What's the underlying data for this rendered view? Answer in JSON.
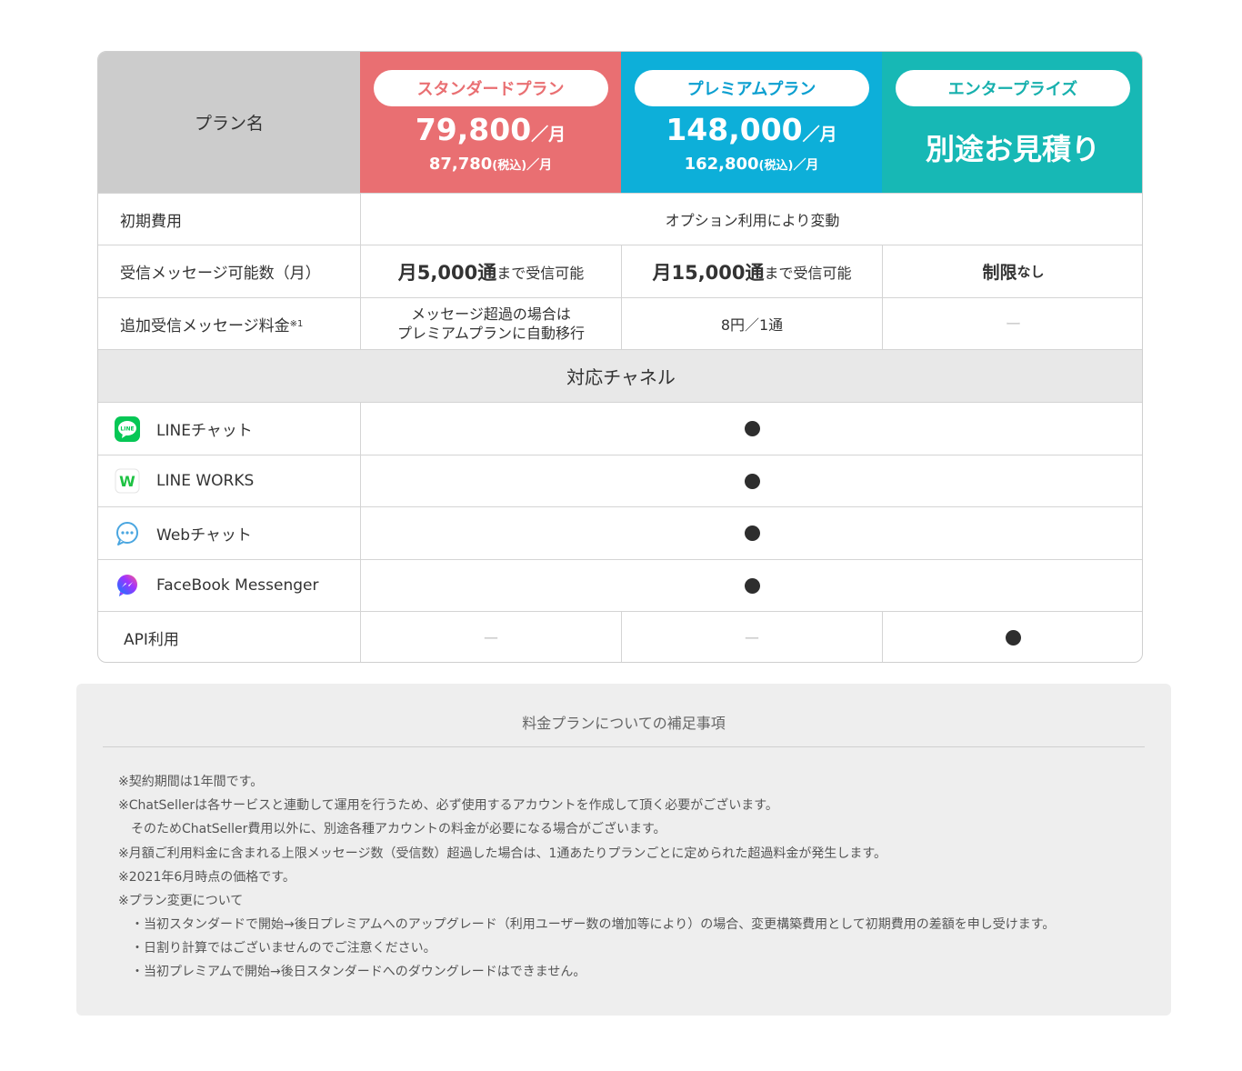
{
  "header": {
    "plan_label": "プラン名",
    "standard": {
      "name": "スタンダードプラン",
      "price": "79,800",
      "unit": "／月",
      "tax_price": "87,780",
      "tax_label": "(税込)",
      "tax_unit": "／月"
    },
    "premium": {
      "name": "プレミアムプラン",
      "price": "148,000",
      "unit": "／月",
      "tax_price": "162,800",
      "tax_label": "(税込)",
      "tax_unit": "／月"
    },
    "enterprise": {
      "name": "エンタープライズ",
      "price": "別途お見積り"
    }
  },
  "rows": {
    "initial": {
      "label": "初期費用",
      "value": "オプション利用により変動"
    },
    "messages": {
      "label": "受信メッセージ可能数（月）",
      "standard_bold": "月5,000通",
      "standard_rest": "まで受信可能",
      "premium_bold": "月15,000通",
      "premium_rest": "まで受信可能",
      "enterprise_bold": "制限",
      "enterprise_rest": "なし"
    },
    "additional": {
      "label": "追加受信メッセージ料金",
      "label_sup": "※1",
      "standard_line1": "メッセージ超過の場合は",
      "standard_line2": "プレミアムプランに自動移行",
      "premium": "8円／1通",
      "enterprise": "ー"
    }
  },
  "channels": {
    "section_title": "対応チャネル",
    "items": [
      {
        "label": "LINEチャット",
        "icon": "line-icon"
      },
      {
        "label": "LINE WORKS",
        "icon": "line-works-icon"
      },
      {
        "label": "Webチャット",
        "icon": "web-chat-icon"
      },
      {
        "label": "FaceBook Messenger",
        "icon": "messenger-icon"
      }
    ],
    "line_icon_text": "LINE",
    "line_works_icon_text": "W"
  },
  "api": {
    "label": "API利用",
    "standard": "ー",
    "premium": "ー"
  },
  "notes": {
    "title": "料金プランについての補足事項",
    "lines": [
      "※契約期間は1年間です。",
      "※ChatSellerは各サービスと連動して運用を行うため、必ず使用するアカウントを作成して頂く必要がございます。",
      "　そのためChatSeller費用以外に、別途各種アカウントの料金が必要になる場合がございます。",
      "※月額ご利用料金に含まれる上限メッセージ数（受信数）超過した場合は、1通あたりプランごとに定められた超過料金が発生します。",
      "※2021年6月時点の価格です。",
      "※プラン変更について",
      "　・当初スタンダードで開始→後日プレミアムへのアップグレード（利用ユーザー数の増加等により）の場合、変更構築費用として初期費用の差額を申し受けます。",
      "　・日割り計算ではございませんのでご注意ください。",
      "　・当初プレミアムで開始→後日スタンダードへのダウングレードはできません。"
    ]
  },
  "colors": {
    "standard": "#e96f72",
    "premium": "#0dafd9",
    "enterprise": "#17b8b5"
  }
}
